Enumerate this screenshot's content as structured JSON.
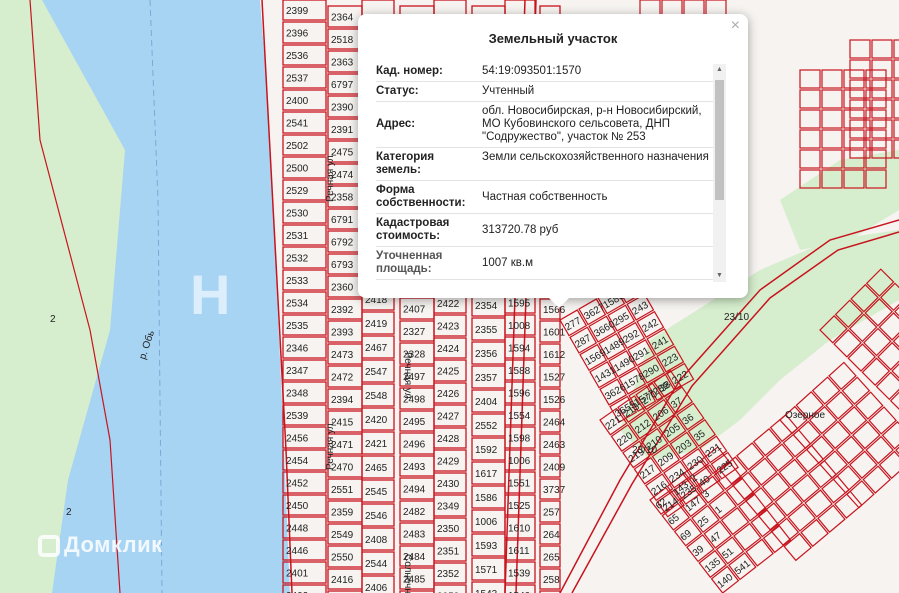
{
  "popup": {
    "title": "Земельный участок",
    "close": "×",
    "rows": [
      {
        "key": "Кад. номер:",
        "value": "54:19:093501:1570"
      },
      {
        "key": "Статус:",
        "value": "Учтенный"
      },
      {
        "key": "Адрес:",
        "value": "обл. Новосибирская, р-н Новосибирский, МО Кубовинского сельсовета, ДНП \"Содружество\", участок № 253"
      },
      {
        "key": "Категория земель:",
        "value": "Земли сельскохозяйственного назначения"
      },
      {
        "key": "Форма собственности:",
        "value": "Частная собственность"
      },
      {
        "key": "Кадастровая стоимость:",
        "value": "313720.78 руб"
      },
      {
        "key": "Уточненная площадь:",
        "value": "1007 кв.м"
      }
    ]
  },
  "watermark": {
    "brand": "Домклик"
  },
  "map": {
    "river_label": "р. Обь",
    "street_labels": [
      "Речная ул.",
      "Речная ул.",
      "Речная ул.",
      "Солнечная ул."
    ],
    "zone_labels": [
      "2",
      "2",
      "23/10",
      "23/10",
      "Озерное"
    ],
    "colors": {
      "river": "#a8d4f4",
      "greenery": "#d6eecd",
      "parcel_line": "#c8141e",
      "background": "#f4f4f2"
    },
    "plots": [
      "2399",
      "2396",
      "2536",
      "2537",
      "2400",
      "2541",
      "2502",
      "2500",
      "2529",
      "2530",
      "2531",
      "2532",
      "2533",
      "2534",
      "2535",
      "2346",
      "2347",
      "2348",
      "2539",
      "2456",
      "2454",
      "2452",
      "2450",
      "2448",
      "2446",
      "2401",
      "2402",
      "2364",
      "2518",
      "2363",
      "6797",
      "2390",
      "2391",
      "2475",
      "2474",
      "2358",
      "6791",
      "6792",
      "6793",
      "2360",
      "2392",
      "2393",
      "2473",
      "2472",
      "2394",
      "2415",
      "2471",
      "2470",
      "2551",
      "2359",
      "2549",
      "2550",
      "2416",
      "2417",
      "2418",
      "2419",
      "2467",
      "2547",
      "2548",
      "2420",
      "2421",
      "2465",
      "2545",
      "2546",
      "2408",
      "2544",
      "2406",
      "2407",
      "2327",
      "2328",
      "2497",
      "2498",
      "2495",
      "2496",
      "2493",
      "2494",
      "2482",
      "2483",
      "2484",
      "2485",
      "2486",
      "2422",
      "2423",
      "2424",
      "2425",
      "2426",
      "2427",
      "2428",
      "2429",
      "2430",
      "2349",
      "2350",
      "2351",
      "2352",
      "2353",
      "2354",
      "2355",
      "2356",
      "2357",
      "2404",
      "2552",
      "1592",
      "1617",
      "1586",
      "1006",
      "1593",
      "1571",
      "1543",
      "1595",
      "1008",
      "1594",
      "1588",
      "1596",
      "1554",
      "1598",
      "1006",
      "1551",
      "1525",
      "1610",
      "1611",
      "1539",
      "1540",
      "1566",
      "1601",
      "1612",
      "1527",
      "1526",
      "2464",
      "2463",
      "2409",
      "3737",
      "257",
      "264",
      "265",
      "258",
      "281",
      "277",
      "287",
      "1569",
      "1431",
      "3626",
      "3655",
      "3627",
      "3660",
      "1489",
      "1490",
      "1578",
      "1577",
      "1580",
      "295",
      "292",
      "291",
      "290",
      "289",
      "246",
      "243",
      "242",
      "241",
      "223",
      "222",
      "221",
      "220",
      "219",
      "217",
      "216",
      "214",
      "213",
      "212",
      "210",
      "209",
      "234",
      "235",
      "270",
      "206",
      "205",
      "203",
      "230",
      "40",
      "38",
      "37",
      "36",
      "35",
      "231",
      "225",
      "62",
      "65",
      "69",
      "39",
      "135",
      "140",
      "143",
      "147",
      "25",
      "47",
      "51",
      "541",
      "2",
      "3",
      "1"
    ]
  }
}
